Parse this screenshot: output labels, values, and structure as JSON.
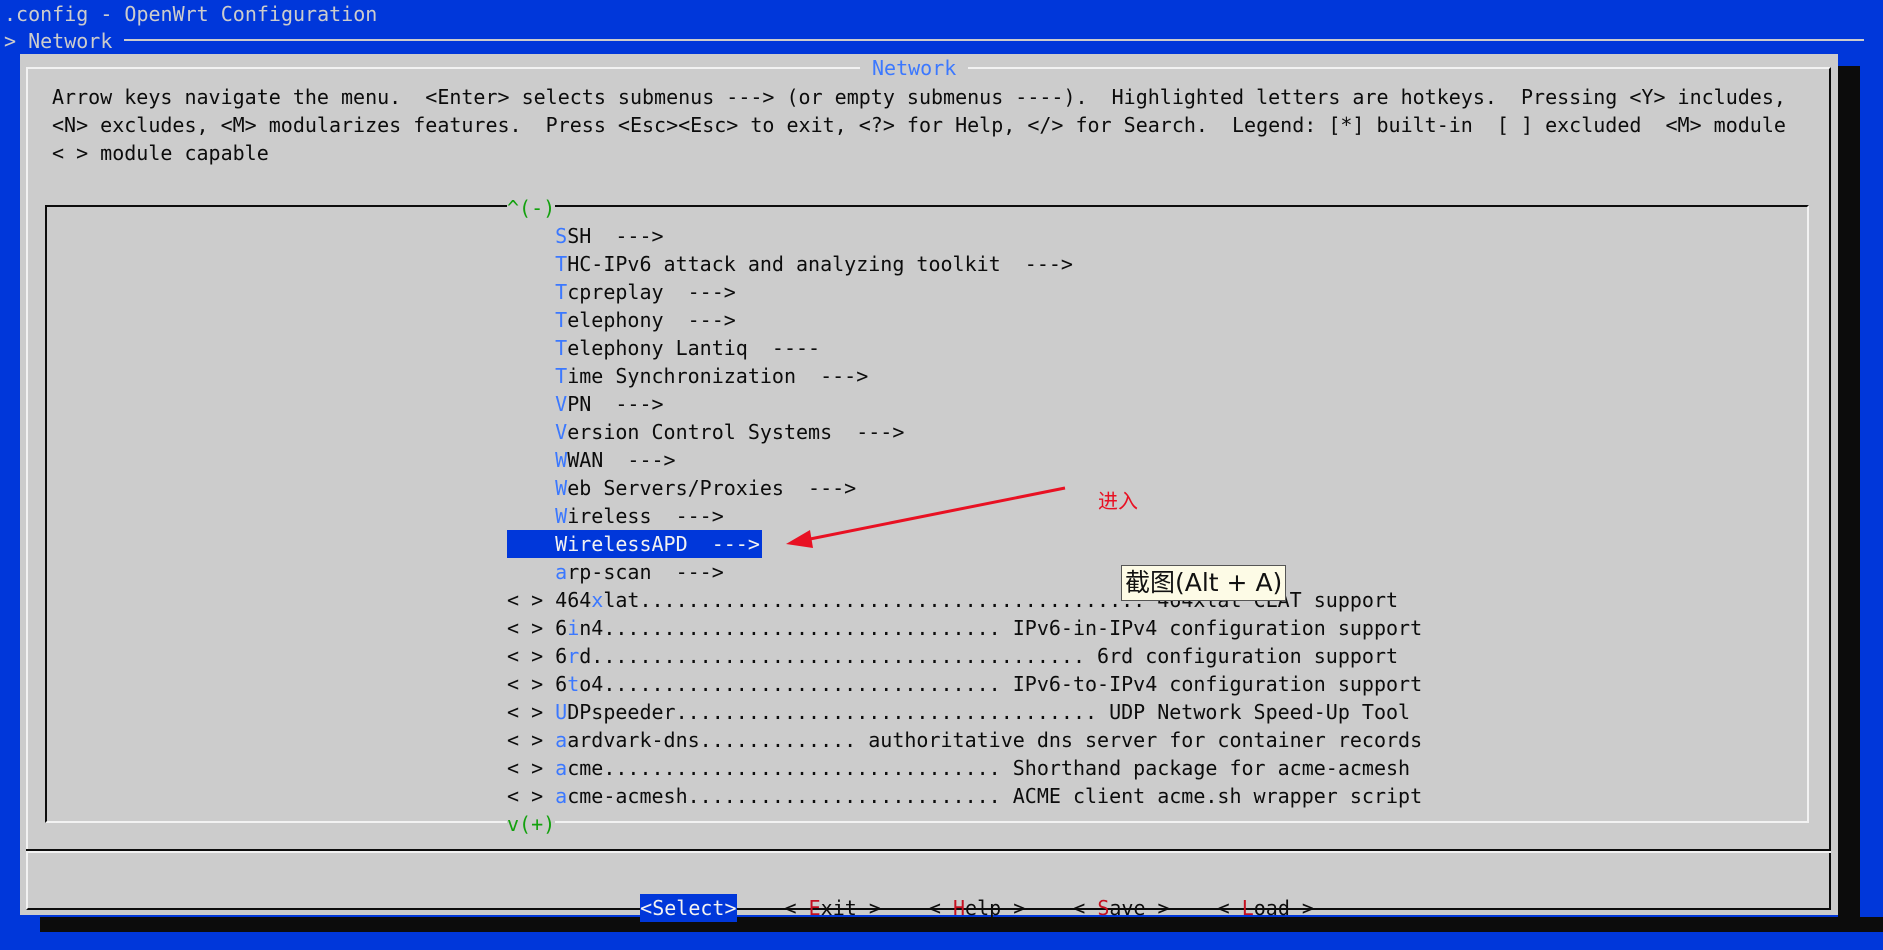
{
  "window": {
    "title": ".config - OpenWrt Configuration",
    "breadcrumb": "> Network"
  },
  "dialog": {
    "title": "Network",
    "help_lines": [
      "Arrow keys navigate the menu.  <Enter> selects submenus ---> (or empty submenus ----).  Highlighted letters are hotkeys.  Pressing <Y> includes,",
      "<N> excludes, <M> modularizes features.  Press <Esc><Esc> to exit, <?> for Help, </> for Search.  Legend: [*] built-in  [ ] excluded  <M> module",
      "< > module capable"
    ],
    "scroll_up": "^(-)",
    "scroll_down": "v(+)"
  },
  "menu": {
    "items": [
      {
        "prefix": "",
        "hotkey": "S",
        "rest": "SH  --->",
        "selected": false
      },
      {
        "prefix": "",
        "hotkey": "T",
        "rest": "HC-IPv6 attack and analyzing toolkit  --->",
        "selected": false
      },
      {
        "prefix": "",
        "hotkey": "T",
        "rest": "cpreplay  --->",
        "selected": false
      },
      {
        "prefix": "",
        "hotkey": "T",
        "rest": "elephony  --->",
        "selected": false
      },
      {
        "prefix": "",
        "hotkey": "T",
        "rest": "elephony Lantiq  ----",
        "selected": false
      },
      {
        "prefix": "",
        "hotkey": "T",
        "rest": "ime Synchronization  --->",
        "selected": false
      },
      {
        "prefix": "",
        "hotkey": "V",
        "rest": "PN  --->",
        "selected": false
      },
      {
        "prefix": "",
        "hotkey": "V",
        "rest": "ersion Control Systems  --->",
        "selected": false
      },
      {
        "prefix": "",
        "hotkey": "W",
        "rest": "WAN  --->",
        "selected": false
      },
      {
        "prefix": "",
        "hotkey": "W",
        "rest": "eb Servers/Proxies  --->",
        "selected": false
      },
      {
        "prefix": "",
        "hotkey": "W",
        "rest": "ireless  --->",
        "selected": false
      },
      {
        "prefix": "",
        "hotkey": "W",
        "rest": "irelessAPD  --->",
        "selected": true
      },
      {
        "prefix": "",
        "hotkey": "a",
        "rest": "rp-scan  --->",
        "selected": false
      },
      {
        "prefix": "< > ",
        "lead": "464",
        "hotkey": "x",
        "rest": "lat.......................................... 464xlat CLAT support",
        "selected": false
      },
      {
        "prefix": "< > ",
        "lead": "6",
        "hotkey": "i",
        "rest": "n4................................. IPv6-in-IPv4 configuration support",
        "selected": false
      },
      {
        "prefix": "< > ",
        "lead": "6",
        "hotkey": "r",
        "rest": "d......................................... 6rd configuration support",
        "selected": false
      },
      {
        "prefix": "< > ",
        "lead": "6",
        "hotkey": "t",
        "rest": "o4................................. IPv6-to-IPv4 configuration support",
        "selected": false
      },
      {
        "prefix": "< > ",
        "lead": "",
        "hotkey": "U",
        "rest": "DPspeeder................................... UDP Network Speed-Up Tool",
        "selected": false
      },
      {
        "prefix": "< > ",
        "lead": "",
        "hotkey": "a",
        "rest": "ardvark-dns............. authoritative dns server for container records",
        "selected": false
      },
      {
        "prefix": "< > ",
        "lead": "",
        "hotkey": "a",
        "rest": "cme................................. Shorthand package for acme-acmesh",
        "selected": false
      },
      {
        "prefix": "< > ",
        "lead": "",
        "hotkey": "a",
        "rest": "cme-acmesh.......................... ACME client acme.sh wrapper script",
        "selected": false
      }
    ]
  },
  "buttons": {
    "select": {
      "left": "<",
      "hotkey": "S",
      "rest": "elect",
      "right": ">"
    },
    "exit": {
      "left": "< ",
      "hotkey": "E",
      "rest": "xit",
      "right": " >"
    },
    "help": {
      "left": "< ",
      "hotkey": "H",
      "rest": "elp",
      "right": " >"
    },
    "save": {
      "left": "< ",
      "hotkey": "S",
      "rest": "ave",
      "right": " >"
    },
    "load": {
      "left": "< ",
      "hotkey": "L",
      "rest": "oad",
      "right": " >"
    }
  },
  "annotation": {
    "label": "进入",
    "color": "#e81123"
  },
  "tooltip": {
    "text": "截图(Alt + A)"
  },
  "colors": {
    "background": "#0037da",
    "dialog": "#cccccc",
    "hotkey_menu": "#3b78ff",
    "hotkey_button": "#c50f1f",
    "scroll_indicator": "#13a10e"
  }
}
